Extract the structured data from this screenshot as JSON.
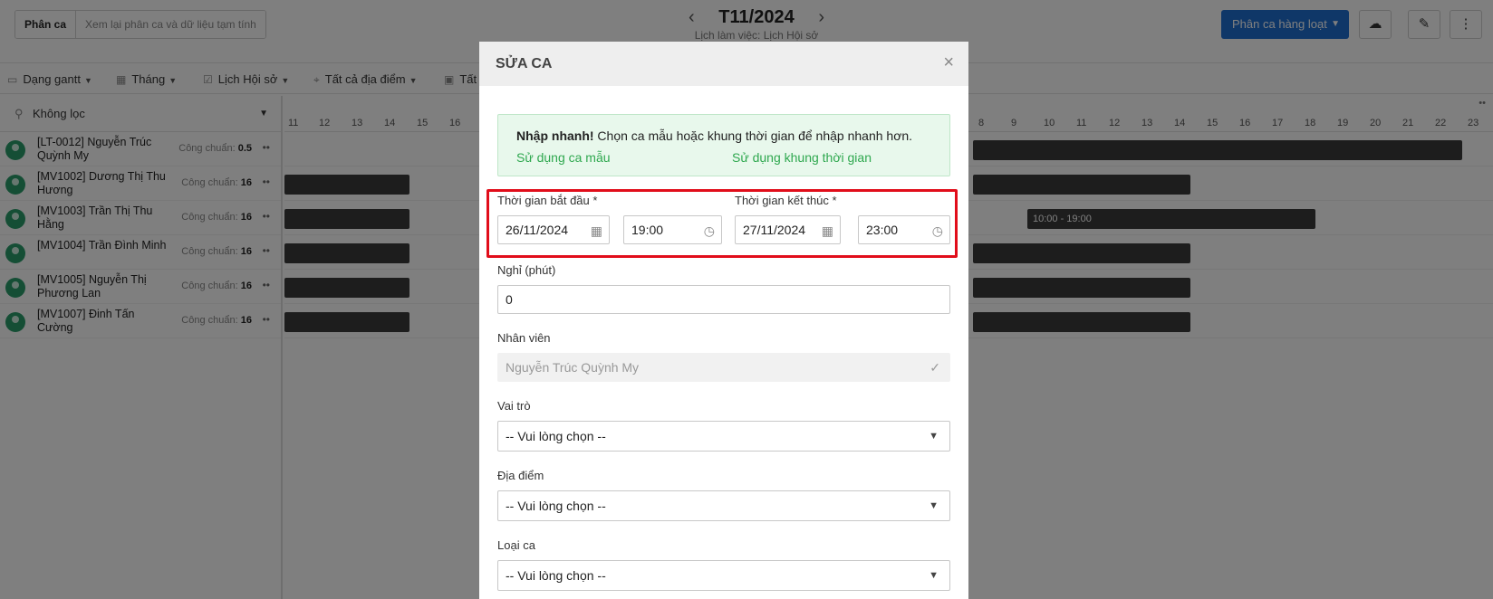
{
  "header": {
    "seg_active": "Phân ca",
    "seg_inactive": "Xem lại phân ca và dữ liệu tạm tính",
    "month_title": "T11/2024",
    "month_subtitle": "Lịch làm việc: Lịch Hội sở",
    "bulk_button": "Phân ca hàng loạt"
  },
  "toolbar": {
    "view_mode": "Dạng gantt",
    "period": "Tháng",
    "calendar": "Lịch Hội sở",
    "locations": "Tất cả địa điểm",
    "more": "Tất"
  },
  "filter": {
    "label": "Không lọc"
  },
  "employees": [
    {
      "name": "[LT-0012] Nguyễn Trúc Quỳnh My",
      "std_label": "Công chuẩn:",
      "std_value": "0.5"
    },
    {
      "name": "[MV1002] Dương Thị Thu Hương",
      "std_label": "Công chuẩn:",
      "std_value": "16"
    },
    {
      "name": "[MV1003] Trần Thị Thu Hằng",
      "std_label": "Công chuẩn:",
      "std_value": "16"
    },
    {
      "name": "[MV1004] Trần Đình Minh",
      "std_label": "Công chuẩn:",
      "std_value": "16"
    },
    {
      "name": "[MV1005] Nguyễn Thị Phương Lan",
      "std_label": "Công chuẩn:",
      "std_value": "16"
    },
    {
      "name": "[MV1007] Đinh Tấn Cường",
      "std_label": "Công chuẩn:",
      "std_value": "16"
    }
  ],
  "timeline": {
    "hours_left": [
      "11",
      "12",
      "13",
      "14",
      "15",
      "16"
    ],
    "hours_right": [
      "8",
      "9",
      "10",
      "11",
      "12",
      "13",
      "14",
      "15",
      "16",
      "17",
      "18",
      "19",
      "20",
      "21",
      "22",
      "23"
    ],
    "shift_label": "10:00 - 19:00",
    "more_icon": "double-dots"
  },
  "modal": {
    "title": "SỬA CA",
    "quick_bold": "Nhập nhanh!",
    "quick_text": " Chọn ca mẫu hoặc khung thời gian để nhập nhanh hơn.",
    "quick_link_template": "Sử dụng ca mẫu",
    "quick_link_timeframe": "Sử dụng khung thời gian",
    "start_label": "Thời gian bắt đầu *",
    "end_label": "Thời gian kết thúc *",
    "start_date": "26/11/2024",
    "start_time": "19:00",
    "end_date": "27/11/2024",
    "end_time": "23:00",
    "break_label": "Nghỉ (phút)",
    "break_value": "0",
    "employee_label": "Nhân viên",
    "employee_value": "Nguyễn Trúc Quỳnh My",
    "role_label": "Vai trò",
    "role_value": "-- Vui lòng chọn --",
    "location_label": "Địa điểm",
    "location_value": "-- Vui lòng chọn --",
    "shift_type_label": "Loại ca",
    "shift_type_value": "-- Vui lòng chọn --"
  },
  "colors": {
    "primary": "#1f6fd1",
    "quick_bg": "#e8f8ec",
    "link_green": "#2fa84f",
    "highlight_red": "#e10d1a",
    "shift_bar": "#3a3a3a",
    "avatar": "#2a9d6b"
  }
}
